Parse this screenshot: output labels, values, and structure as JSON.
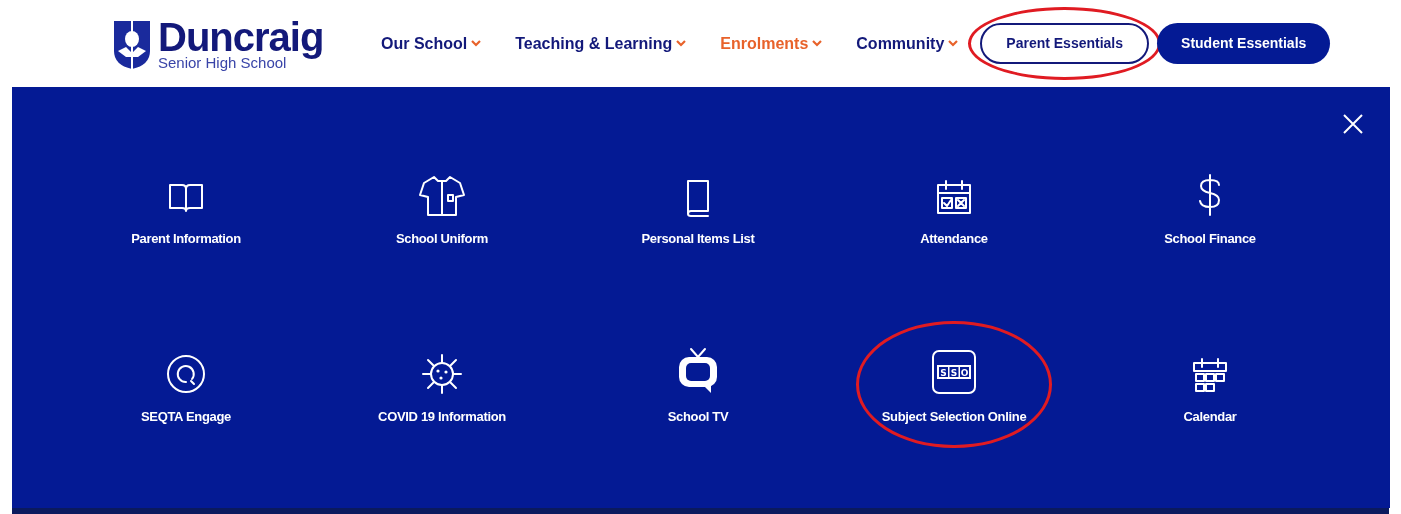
{
  "logo": {
    "name": "Duncraig",
    "subtitle": "Senior High School"
  },
  "nav": [
    {
      "label": "Our School",
      "selected": false
    },
    {
      "label": "Teaching & Learning",
      "selected": false
    },
    {
      "label": "Enrolments",
      "selected": true
    },
    {
      "label": "Community",
      "selected": false
    }
  ],
  "essentials_buttons": [
    {
      "label": "Parent Essentials",
      "selected": true,
      "circled": true
    },
    {
      "label": "Student Essentials",
      "selected": false,
      "circled": false
    }
  ],
  "menu_panel": {
    "items": [
      {
        "label": "Parent Information",
        "kind": "book",
        "circled": false
      },
      {
        "label": "School Uniform",
        "kind": "shirt",
        "circled": false
      },
      {
        "label": "Personal Items List",
        "kind": "notebook",
        "circled": false
      },
      {
        "label": "Attendance",
        "kind": "attendance",
        "circled": false
      },
      {
        "label": "School Finance",
        "kind": "dollar",
        "circled": false
      },
      {
        "label": "SEQTA Engage",
        "kind": "chat",
        "circled": false
      },
      {
        "label": "COVID 19 Information",
        "kind": "virus",
        "circled": false
      },
      {
        "label": "School TV",
        "kind": "tv",
        "circled": false
      },
      {
        "label": "Subject Selection Online",
        "kind": "badge",
        "icon_text": [
          "S",
          "S",
          "O"
        ],
        "circled": true
      },
      {
        "label": "Calendar",
        "kind": "calendar",
        "circled": false
      }
    ]
  }
}
